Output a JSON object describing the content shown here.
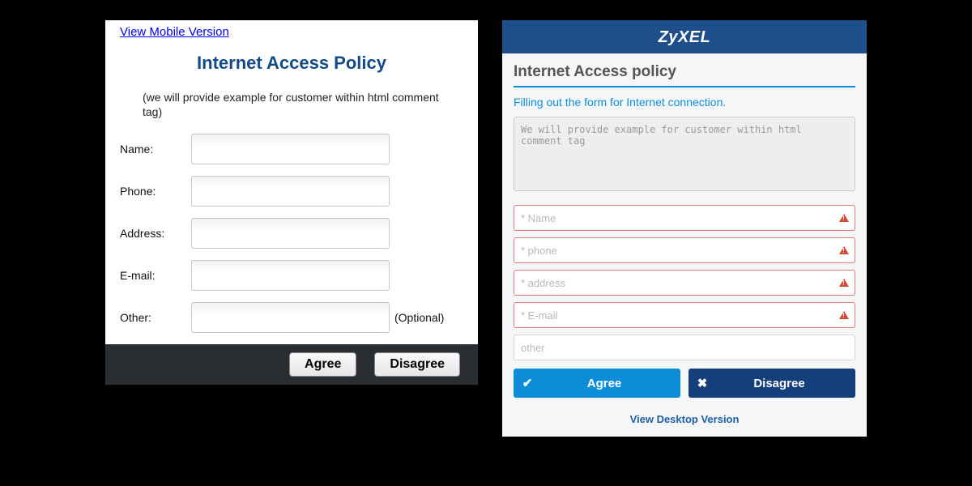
{
  "desktop": {
    "mobile_link": "View Mobile Version",
    "title": "Internet Access Policy",
    "hint": "(we will provide example for customer within html comment tag)",
    "fields": {
      "name_label": "Name:",
      "phone_label": "Phone:",
      "address_label": "Address:",
      "email_label": "E-mail:",
      "other_label": "Other:",
      "optional": "(Optional)"
    },
    "buttons": {
      "agree": "Agree",
      "disagree": "Disagree"
    }
  },
  "mobile": {
    "brand": "ZyXEL",
    "title": "Internet Access policy",
    "subtitle": "Filling out the form for Internet connection.",
    "textarea": "We will provide example for customer within html comment tag",
    "placeholders": {
      "name": "* Name",
      "phone": "* phone",
      "address": "* address",
      "email": "* E-mail",
      "other": "other"
    },
    "buttons": {
      "agree": "Agree",
      "disagree": "Disagree"
    },
    "desktop_link": "View Desktop Version"
  }
}
